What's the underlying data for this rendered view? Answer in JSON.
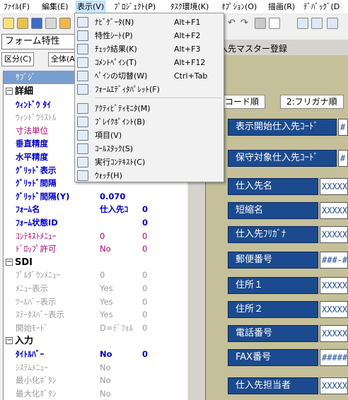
{
  "menubar": {
    "items": [
      "ﾌｧｲﾙ(F)",
      "編集(E)",
      "表示(V)",
      "ﾌﾟﾛｼﾞｪｸﾄ(P)",
      "ﾀｽｸ環境(K)",
      "ｵﾌﾟｼｮﾝ(O)",
      "描画(R)",
      "ﾃﾞﾊﾞｯｸﾞ(D"
    ]
  },
  "view_menu": {
    "items": [
      {
        "label": "ﾅﾋﾞｹﾞｰﾀ(N)",
        "shortcut": "Alt+F1",
        "icon": "navigator-icon"
      },
      {
        "label": "特性ｼｰﾄ(P)",
        "shortcut": "Alt+F2",
        "icon": "property-sheet-icon"
      },
      {
        "label": "ﾁｪｯｸ結果(K)",
        "shortcut": "Alt+F3",
        "icon": "check-result-icon"
      },
      {
        "label": "ｺﾒﾝﾄﾍﾟｲﾝ(T)",
        "shortcut": "Alt+F12",
        "icon": "comment-pane-icon"
      },
      {
        "label": "ﾍﾟｲﾝの切替(W)",
        "shortcut": "Ctrl+Tab",
        "icon": "pane-switch-icon"
      },
      {
        "label": "ﾌｫｰﾑｴﾃﾞｨﾀﾊﾟﾚｯﾄ(F)",
        "shortcut": "",
        "icon": "form-palette-icon"
      },
      {
        "label": "ｱｸﾃｨﾋﾞﾃｨﾓﾆﾀ(M)",
        "shortcut": "",
        "icon": "activity-monitor-icon"
      },
      {
        "label": "ﾌﾞﾚｲｸﾎﾟｲﾝﾄ(B)",
        "shortcut": "",
        "icon": "breakpoint-icon"
      },
      {
        "label": "項目(V)",
        "shortcut": "",
        "icon": "item-icon"
      },
      {
        "label": "ｺｰﾙｽﾀｯｸ(S)",
        "shortcut": "",
        "icon": "call-stack-icon"
      },
      {
        "label": "実行ｺﾝﾃｷｽﾄ(C)",
        "shortcut": "",
        "icon": "exec-context-icon"
      },
      {
        "label": "ｳｫｯﾁ(H)",
        "shortcut": "",
        "icon": "watch-icon"
      }
    ]
  },
  "property_panel": {
    "title": "フォーム特性",
    "tab_category": "区分(C)",
    "tab_all": "全体(A)",
    "header": "ｻﾌﾞｼﾞ",
    "rows": [
      {
        "type": "section",
        "name": "詳細",
        "toggle": "⊟"
      },
      {
        "name": "ｳｨﾝﾄﾞｳ ﾀｲ",
        "style": "blue",
        "value": "",
        "value2": ""
      },
      {
        "name": "ｳｨﾝﾄﾞｳﾘｽﾄﾙ",
        "style": "gray",
        "value": "",
        "value2": ""
      },
      {
        "name": "寸法単位",
        "style": "mag",
        "value": "",
        "value2": ""
      },
      {
        "name": "垂直精度",
        "style": "blue",
        "value": "",
        "value2": ""
      },
      {
        "name": "水平精度",
        "style": "blue",
        "value": "",
        "value2": ""
      },
      {
        "name": "ｸﾞﾘｯﾄﾞ表示",
        "style": "blue",
        "value": "",
        "value2": ""
      },
      {
        "name": "ｸﾞﾘｯﾄﾞ間隔",
        "style": "blue",
        "value": "",
        "value2": ""
      },
      {
        "name": "ｸﾞﾘｯﾄﾞ間隔(Y)",
        "style": "blue",
        "value": "0.070",
        "value2": ""
      },
      {
        "name": "ﾌｫｰﾑ名",
        "style": "blue",
        "value": "仕入先ｺ",
        "value2": "0"
      },
      {
        "name": "ﾌｫｰﾑ状態ID",
        "style": "blue",
        "value": "",
        "value2": "0"
      },
      {
        "name": "ｺﾝﾃｷｽﾄﾒﾆｭｰ",
        "style": "mag",
        "value": "0",
        "value2": "0"
      },
      {
        "name": "ﾄﾞﾛｯﾌﾟ許可",
        "style": "mag",
        "value": "No",
        "value2": "0"
      },
      {
        "type": "section",
        "name": "SDI",
        "toggle": "⊟"
      },
      {
        "name": "ﾌﾟﾙﾀﾞｳﾝﾒﾆｭｰ",
        "style": "gray",
        "value": "0",
        "value2": "0"
      },
      {
        "name": "ﾒﾆｭｰ表示",
        "style": "gray",
        "value": "Yes",
        "value2": "0"
      },
      {
        "name": "ﾂｰﾙﾊﾞｰ表示",
        "style": "gray",
        "value": "Yes",
        "value2": "0"
      },
      {
        "name": "ｽﾃｰﾀｽﾊﾞｰ表示",
        "style": "gray",
        "value": "Yes",
        "value2": "0"
      },
      {
        "name": "開始ﾓｰﾄﾞ",
        "style": "gray",
        "value": "D=ﾃﾞﾌｫﾙ",
        "value2": "0"
      },
      {
        "type": "section",
        "name": "入力",
        "toggle": "⊟"
      },
      {
        "name": "ﾀｲﾄﾙﾊﾞｰ",
        "style": "blue",
        "value": "No",
        "value2": "0"
      },
      {
        "name": "ｼｽﾃﾑﾒﾆｭｰ",
        "style": "gray",
        "value": "No",
        "value2": ""
      },
      {
        "name": "最小化ﾎﾞﾀﾝ",
        "style": "gray",
        "value": "No",
        "value2": ""
      },
      {
        "name": "最大化ﾎﾞﾀﾝ",
        "style": "gray",
        "value": "No",
        "value2": ""
      },
      {
        "name": "ﾊﾟﾚｯﾄ最適化",
        "style": "mag",
        "value": "No",
        "value2": ""
      }
    ]
  },
  "designer": {
    "form_title": "入先マスター登録",
    "tabs": [
      ":コード順",
      "2:フリガナ順"
    ],
    "fields": [
      {
        "label": "表示開始仕入先ｺｰﾄﾞ",
        "value": "#"
      },
      {
        "label": "保守対象仕入先ｺｰﾄﾞ",
        "value": "#"
      },
      {
        "label": "仕入先名",
        "value": "XXXXX"
      },
      {
        "label": "短縮名",
        "value": "XXXXX"
      },
      {
        "label": "仕入先ﾌﾘｶﾞﾅ",
        "value": "XXXXX"
      },
      {
        "label": "郵便番号",
        "value": "###-#"
      },
      {
        "label": "住所１",
        "value": "XXXXX"
      },
      {
        "label": "住所２",
        "value": "XXXXX"
      },
      {
        "label": "電話番号",
        "value": "XXXXX"
      },
      {
        "label": "FAX番号",
        "value": "#####"
      },
      {
        "label": "仕入先担当者",
        "value": "XXXXX"
      }
    ]
  },
  "colors": {
    "menu_highlight": "#cce8ff",
    "field_label_bg": "#1c4a8e",
    "form_bg": "#c5c09a",
    "prop_blue": "#0000c8",
    "prop_magenta": "#b0006b",
    "prop_gray": "#9a9a9a"
  }
}
